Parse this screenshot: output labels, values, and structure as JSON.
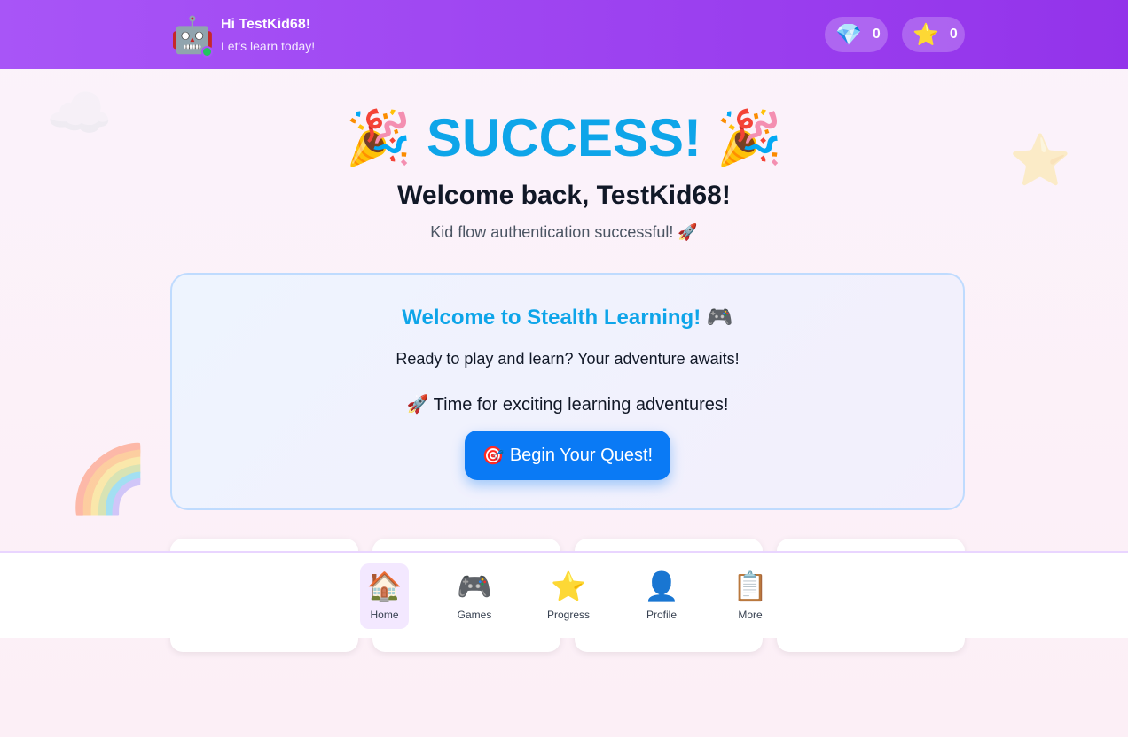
{
  "header": {
    "avatar_icon": "🤖",
    "greeting": "Hi TestKid68!",
    "subtitle": "Let's learn today!",
    "gems": {
      "icon": "💎",
      "count": "0"
    },
    "stars": {
      "icon": "⭐",
      "count": "0"
    },
    "accent": "#a855f7"
  },
  "decor": {
    "cloud": "☁️",
    "star": "⭐",
    "rainbow": "🌈"
  },
  "hero": {
    "confetti": "🎉",
    "title": "SUCCESS!",
    "welcome": "Welcome back, TestKid68!",
    "message": "Kid flow authentication successful! 🚀"
  },
  "card": {
    "title": "Welcome to Stealth Learning! 🎮",
    "subtitle": "Ready to play and learn? Your adventure awaits!",
    "adventure": "🚀 Time for exciting learning adventures!",
    "button_icon": "🎯",
    "button_label": "Begin Your Quest!",
    "button_color": "#0a7af5"
  },
  "tiles": [
    {
      "icon": "🏆"
    },
    {
      "icon": "🎮"
    },
    {
      "icon": "🎯"
    },
    {
      "icon": "🌟"
    }
  ],
  "nav": {
    "items": [
      {
        "icon": "🏠",
        "label": "Home"
      },
      {
        "icon": "🎮",
        "label": "Games"
      },
      {
        "icon": "⭐",
        "label": "Progress"
      },
      {
        "icon": "👤",
        "label": "Profile"
      },
      {
        "icon": "📋",
        "label": "More"
      }
    ]
  }
}
